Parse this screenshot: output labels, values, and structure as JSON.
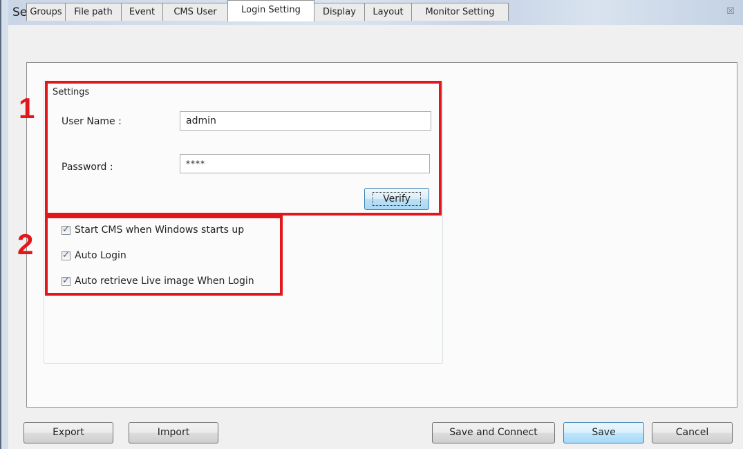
{
  "window": {
    "title": "Settings",
    "close_glyph": "☒"
  },
  "tabs": [
    {
      "label": "Groups"
    },
    {
      "label": "File path"
    },
    {
      "label": "Event"
    },
    {
      "label": "CMS User"
    },
    {
      "label": "Login Setting",
      "active": true
    },
    {
      "label": "Display"
    },
    {
      "label": "Layout"
    },
    {
      "label": "Monitor Setting"
    }
  ],
  "login": {
    "group_title": "Settings",
    "username_label": "User Name :",
    "username_value": "admin",
    "password_label": "Password :",
    "password_value": "****",
    "verify_label": "Verify"
  },
  "options": [
    {
      "label": "Start CMS when Windows starts up",
      "checked": true
    },
    {
      "label": "Auto Login",
      "checked": true
    },
    {
      "label": "Auto retrieve Live image When Login",
      "checked": true
    }
  ],
  "annotations": [
    {
      "number": "1"
    },
    {
      "number": "2"
    }
  ],
  "footer": {
    "export_label": "Export",
    "import_label": "Import",
    "save_connect_label": "Save and Connect",
    "save_label": "Save",
    "cancel_label": "Cancel"
  },
  "colors": {
    "annotation_red": "#e3161b",
    "titlebar": "#c9d6e6",
    "default_button_border": "#3c7fb1"
  }
}
